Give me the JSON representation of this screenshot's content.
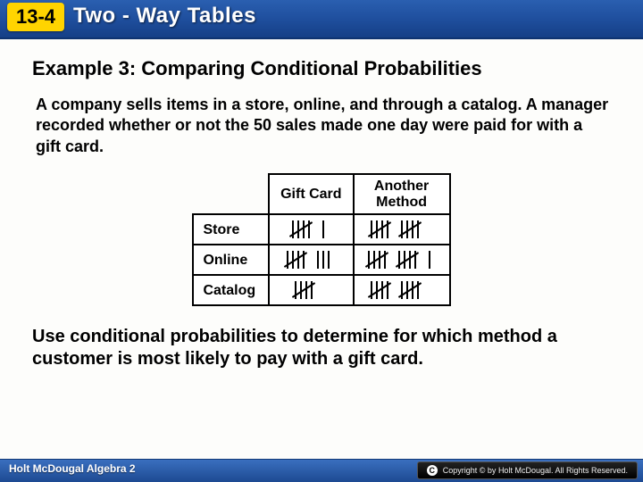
{
  "header": {
    "section": "13-4",
    "title": "Two - Way Tables"
  },
  "example": {
    "heading": "Example 3: Comparing Conditional Probabilities",
    "problem": "A company sells items in a store, online, and through a catalog. A manager recorded whether or not the 50 sales made one day were paid for with a gift card.",
    "question": "Use conditional probabilities to determine for which method a customer is most likely to pay with a gift card."
  },
  "table": {
    "col_headers": [
      "Gift Card",
      "Another Method"
    ],
    "row_headers": [
      "Store",
      "Online",
      "Catalog"
    ],
    "tallies": [
      [
        6,
        10
      ],
      [
        8,
        11
      ],
      [
        5,
        10
      ]
    ]
  },
  "chart_data": {
    "type": "table",
    "title": "Sales by channel and payment method (tally counts)",
    "row_categories": [
      "Store",
      "Online",
      "Catalog"
    ],
    "col_categories": [
      "Gift Card",
      "Another Method"
    ],
    "values": [
      [
        6,
        10
      ],
      [
        8,
        11
      ],
      [
        5,
        10
      ]
    ]
  },
  "footer": {
    "left": "Holt McDougal Algebra 2",
    "copyright": "Copyright © by Holt McDougal. All Rights Reserved."
  }
}
